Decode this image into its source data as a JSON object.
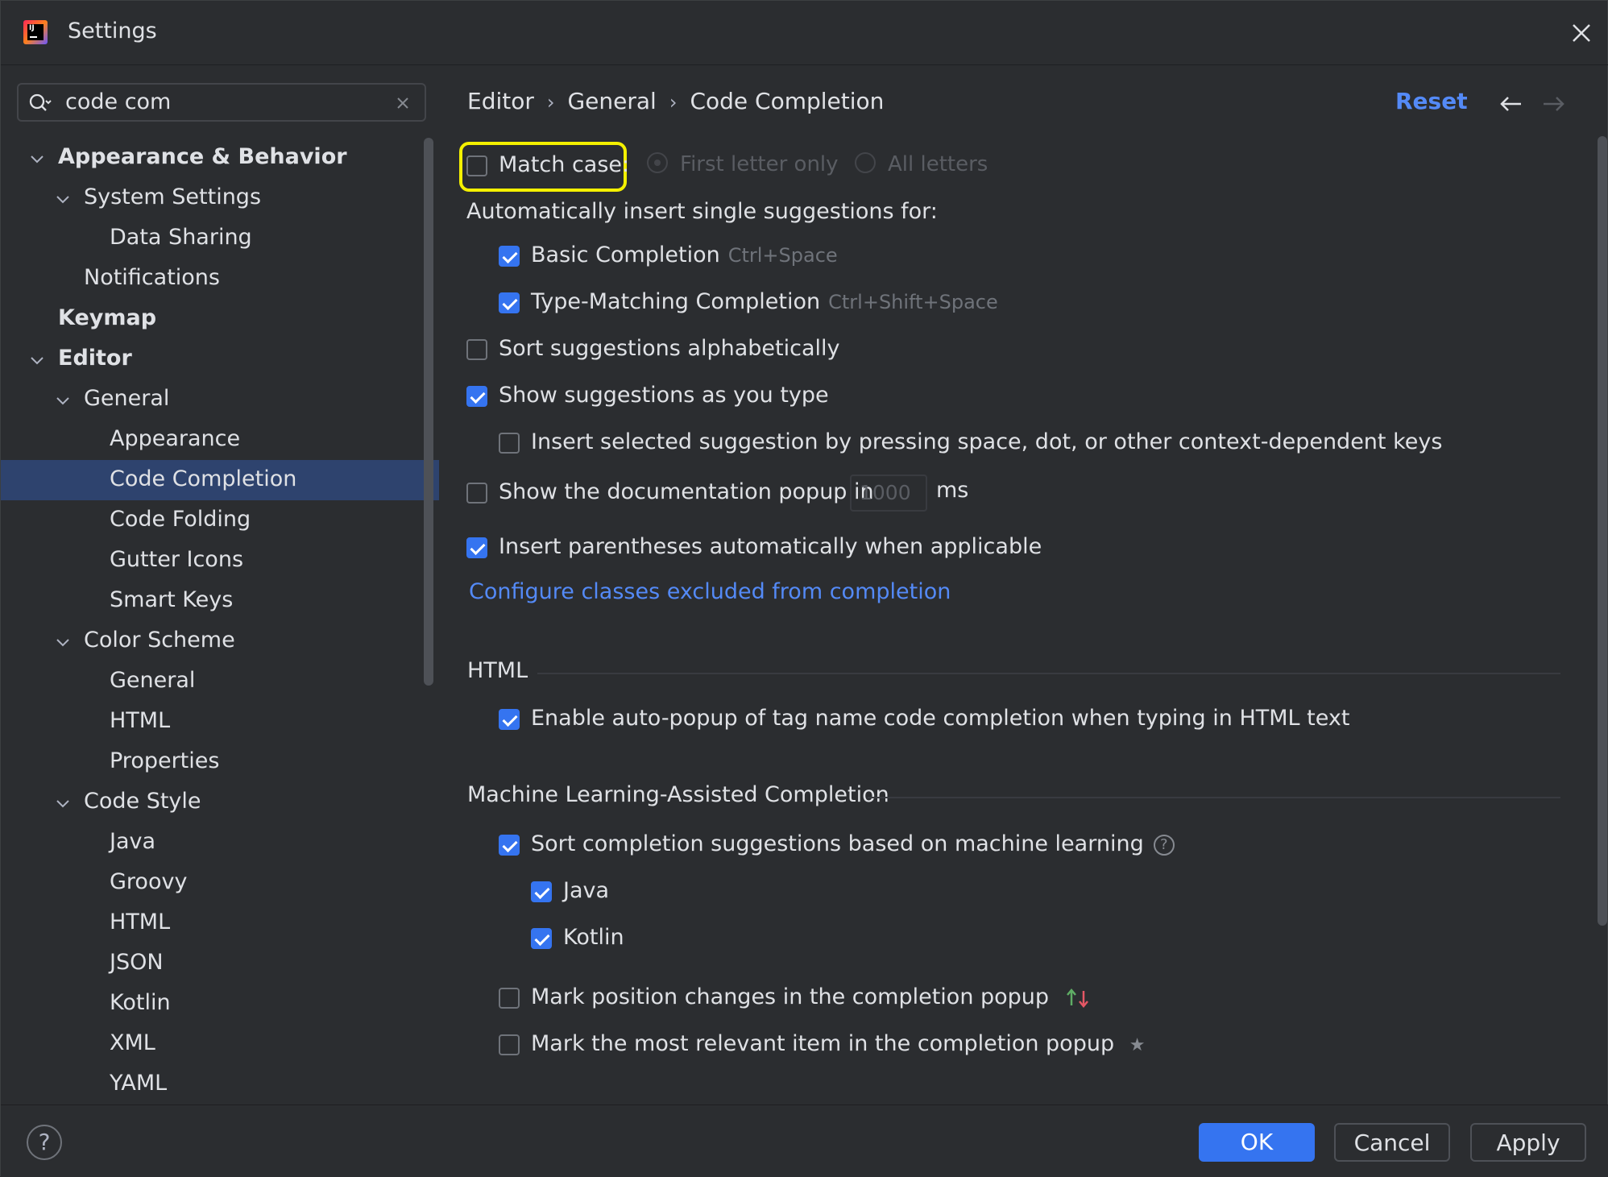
{
  "window": {
    "title": "Settings"
  },
  "search": {
    "value": "code com"
  },
  "tree": [
    {
      "label": "Appearance & Behavior",
      "bold": true,
      "expanded": true
    },
    {
      "label": "System Settings",
      "bold": false,
      "expanded": true
    },
    {
      "label": "Data Sharing",
      "bold": false
    },
    {
      "label": "Notifications",
      "bold": false
    },
    {
      "label": "Keymap",
      "bold": true
    },
    {
      "label": "Editor",
      "bold": true,
      "expanded": true
    },
    {
      "label": "General",
      "bold": false,
      "expanded": true
    },
    {
      "label": "Appearance",
      "bold": false
    },
    {
      "label": "Code Completion",
      "bold": false,
      "selected": true
    },
    {
      "label": "Code Folding",
      "bold": false
    },
    {
      "label": "Gutter Icons",
      "bold": false
    },
    {
      "label": "Smart Keys",
      "bold": false
    },
    {
      "label": "Color Scheme",
      "bold": false,
      "expanded": true
    },
    {
      "label": "General",
      "bold": false
    },
    {
      "label": "HTML",
      "bold": false
    },
    {
      "label": "Properties",
      "bold": false
    },
    {
      "label": "Code Style",
      "bold": false,
      "expanded": true
    },
    {
      "label": "Java",
      "bold": false
    },
    {
      "label": "Groovy",
      "bold": false
    },
    {
      "label": "HTML",
      "bold": false
    },
    {
      "label": "JSON",
      "bold": false
    },
    {
      "label": "Kotlin",
      "bold": false
    },
    {
      "label": "XML",
      "bold": false
    },
    {
      "label": "YAML",
      "bold": false
    }
  ],
  "breadcrumb": {
    "a": "Editor",
    "b": "General",
    "c": "Code Completion"
  },
  "header": {
    "reset": "Reset"
  },
  "match_case": {
    "label": "Match case:",
    "checked": false,
    "opt1": "First letter only",
    "opt2": "All letters"
  },
  "auto_insert": {
    "label": "Automatically insert single suggestions for:"
  },
  "basic": {
    "label": "Basic Completion",
    "shortcut": "Ctrl+Space",
    "checked": true
  },
  "typematch": {
    "label": "Type-Matching Completion",
    "shortcut": "Ctrl+Shift+Space",
    "checked": true
  },
  "sort_alpha": {
    "label": "Sort suggestions alphabetically",
    "checked": false
  },
  "show_typing": {
    "label": "Show suggestions as you type",
    "checked": true
  },
  "insert_selected": {
    "label": "Insert selected suggestion by pressing space, dot, or other context-dependent keys",
    "checked": false
  },
  "doc_popup": {
    "label": "Show the documentation popup in",
    "value": "1000",
    "unit": "ms",
    "checked": false
  },
  "parens": {
    "label": "Insert parentheses automatically when applicable",
    "checked": true
  },
  "configure_link": "Configure classes excluded from completion",
  "html_section": {
    "title": "HTML",
    "autopopup": "Enable auto-popup of tag name code completion when typing in HTML text"
  },
  "ml_section": {
    "title": "Machine Learning-Assisted Completion",
    "sort_ml": "Sort completion suggestions based on machine learning",
    "java": "Java",
    "kotlin": "Kotlin",
    "mark_position": "Mark position changes in the completion popup",
    "mark_relevant": "Mark the most relevant item in the completion popup"
  },
  "footer": {
    "help": "?",
    "ok": "OK",
    "cancel": "Cancel",
    "apply": "Apply"
  },
  "colors": {
    "accent": "#3574f0",
    "link": "#548af7",
    "selection": "#2e436e",
    "highlight": "#f4f000"
  }
}
